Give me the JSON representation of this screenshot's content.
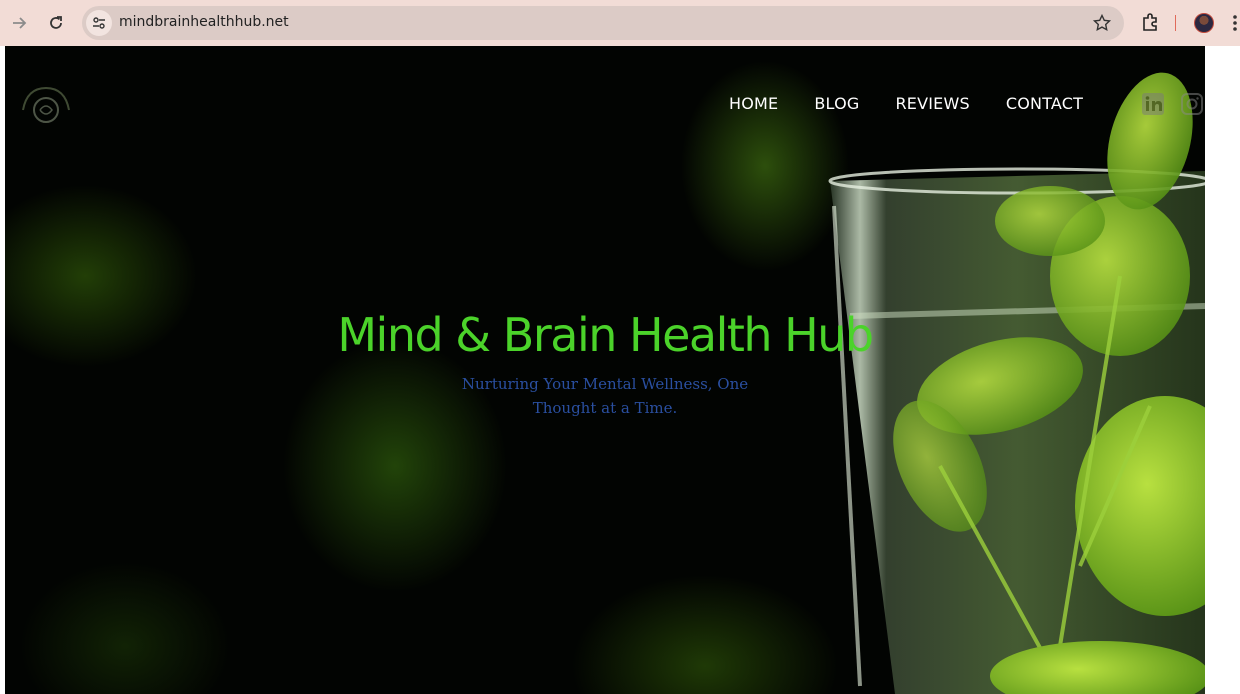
{
  "browser": {
    "url": "mindbrainhealthhub.net",
    "icons": {
      "back": "arrow-right-icon",
      "reload": "reload-icon",
      "site_info": "tune-icon",
      "bookmark": "star-icon",
      "extensions": "puzzle-icon",
      "menu": "kebab-menu-icon"
    }
  },
  "site": {
    "logo_icon": "brain-logo-icon",
    "nav": [
      {
        "label": "HOME"
      },
      {
        "label": "BLOG"
      },
      {
        "label": "REVIEWS"
      },
      {
        "label": "CONTACT"
      }
    ],
    "social": [
      "linkedin-icon",
      "instagram-icon"
    ],
    "hero": {
      "title": "Mind & Brain Health Hub",
      "subtitle_line1": "Nurturing Your Mental Wellness, One",
      "subtitle_line2": "Thought at a Time."
    },
    "colors": {
      "title": "#4bd32a",
      "subtitle": "#2a4fa0",
      "nav": "#ffffff",
      "background": "#020402",
      "chrome": "#f2dcd6"
    }
  }
}
